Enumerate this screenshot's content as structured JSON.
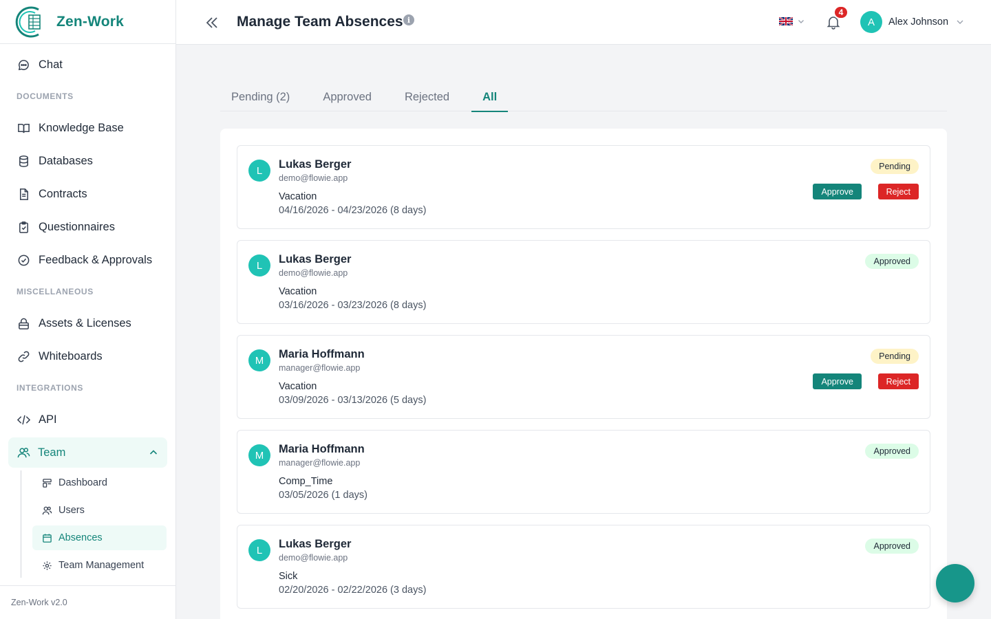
{
  "app": {
    "name": "Zen-Work",
    "version": "Zen-Work v2.0"
  },
  "sidebar": {
    "chat": "Chat",
    "sections": {
      "documents": "DOCUMENTS",
      "misc": "MISCELLANEOUS",
      "integrations": "INTEGRATIONS"
    },
    "documents": [
      "Knowledge Base",
      "Databases",
      "Contracts",
      "Questionnaires",
      "Feedback & Approvals"
    ],
    "misc": [
      "Assets & Licenses",
      "Whiteboards"
    ],
    "integrations": [
      "API"
    ],
    "team": {
      "label": "Team",
      "items": [
        "Dashboard",
        "Users",
        "Absences",
        "Team Management"
      ],
      "active": "Absences"
    }
  },
  "header": {
    "title": "Manage Team Absences",
    "notification_count": "4",
    "user": {
      "initial": "A",
      "name": "Alex Johnson"
    }
  },
  "tabs": [
    "Pending (2)",
    "Approved",
    "Rejected",
    "All"
  ],
  "active_tab": "All",
  "actions": {
    "approve": "Approve",
    "reject": "Reject"
  },
  "absences": [
    {
      "initial": "L",
      "name": "Lukas Berger",
      "email": "demo@flowie.app",
      "type": "Vacation",
      "dates": "04/16/2026 - 04/23/2026 (8 days)",
      "status": "Pending"
    },
    {
      "initial": "L",
      "name": "Lukas Berger",
      "email": "demo@flowie.app",
      "type": "Vacation",
      "dates": "03/16/2026 - 03/23/2026 (8 days)",
      "status": "Approved"
    },
    {
      "initial": "M",
      "name": "Maria Hoffmann",
      "email": "manager@flowie.app",
      "type": "Vacation",
      "dates": "03/09/2026 - 03/13/2026 (5 days)",
      "status": "Pending"
    },
    {
      "initial": "M",
      "name": "Maria Hoffmann",
      "email": "manager@flowie.app",
      "type": "Comp_Time",
      "dates": "03/05/2026 (1 days)",
      "status": "Approved"
    },
    {
      "initial": "L",
      "name": "Lukas Berger",
      "email": "demo@flowie.app",
      "type": "Sick",
      "dates": "02/20/2026 - 02/22/2026 (3 days)",
      "status": "Approved"
    }
  ]
}
